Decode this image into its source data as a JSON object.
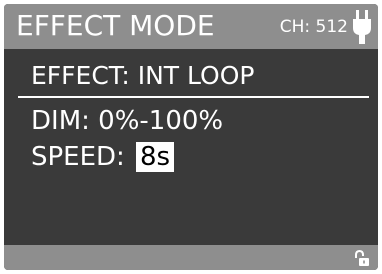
{
  "header": {
    "title": "EFFECT MODE",
    "channel": "CH: 512",
    "icon": "plug-icon"
  },
  "main": {
    "effect": "EFFECT: INT LOOP",
    "dim": "DIM: 0%-100%",
    "speed_label": "SPEED:",
    "speed_value": "8s"
  },
  "footer": {
    "icon": "unlocked-padlock-icon"
  },
  "colors": {
    "screen_background": "#3a3a3a",
    "bar_background": "#8e8e8e",
    "text": "#ffffff",
    "selection_background": "#ffffff",
    "selection_text": "#000000"
  }
}
